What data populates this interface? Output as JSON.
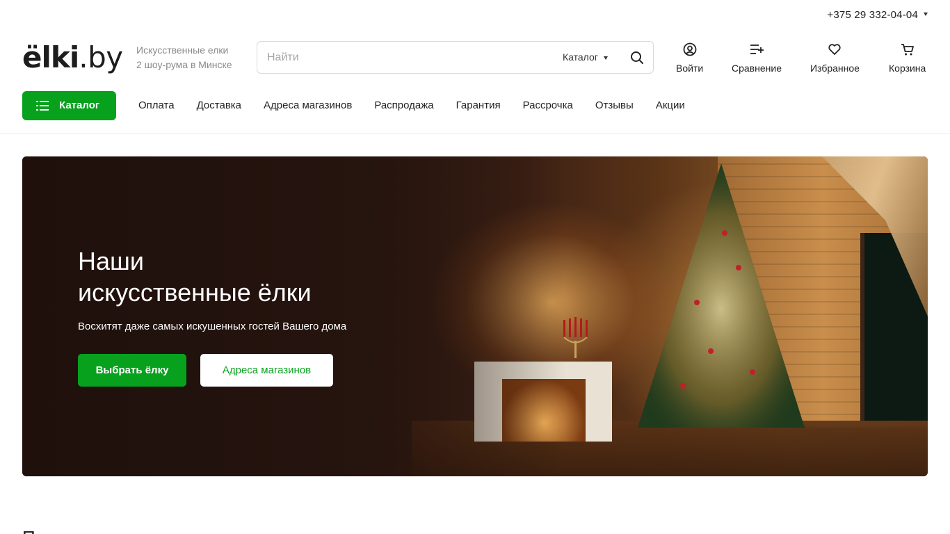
{
  "topbar": {
    "phone": "+375 29 332-04-04"
  },
  "header": {
    "logo_main": "ёlki",
    "logo_tld": ".by",
    "tagline_line1": "Искусственные елки",
    "tagline_line2": "2 шоу-рума в Минске",
    "search": {
      "placeholder": "Найти",
      "category": "Каталог"
    },
    "actions": [
      {
        "label": "Войти",
        "icon": "user-icon"
      },
      {
        "label": "Сравнение",
        "icon": "compare-icon"
      },
      {
        "label": "Избранное",
        "icon": "heart-icon"
      },
      {
        "label": "Корзина",
        "icon": "cart-icon"
      }
    ]
  },
  "nav": {
    "catalog_label": "Каталог",
    "items": [
      "Оплата",
      "Доставка",
      "Адреса магазинов",
      "Распродажа",
      "Гарантия",
      "Рассрочка",
      "Отзывы",
      "Акции"
    ]
  },
  "hero": {
    "title_line1": "Наши",
    "title_line2": "искусственные ёлки",
    "subtitle": "Восхитят даже самых искушенных гостей Вашего дома",
    "primary_button": "Выбрать ёлку",
    "secondary_button": "Адреса магазинов"
  },
  "colors": {
    "accent": "#08a11e",
    "text": "#222222",
    "muted": "#8a8a8a"
  },
  "section_peek": "П"
}
